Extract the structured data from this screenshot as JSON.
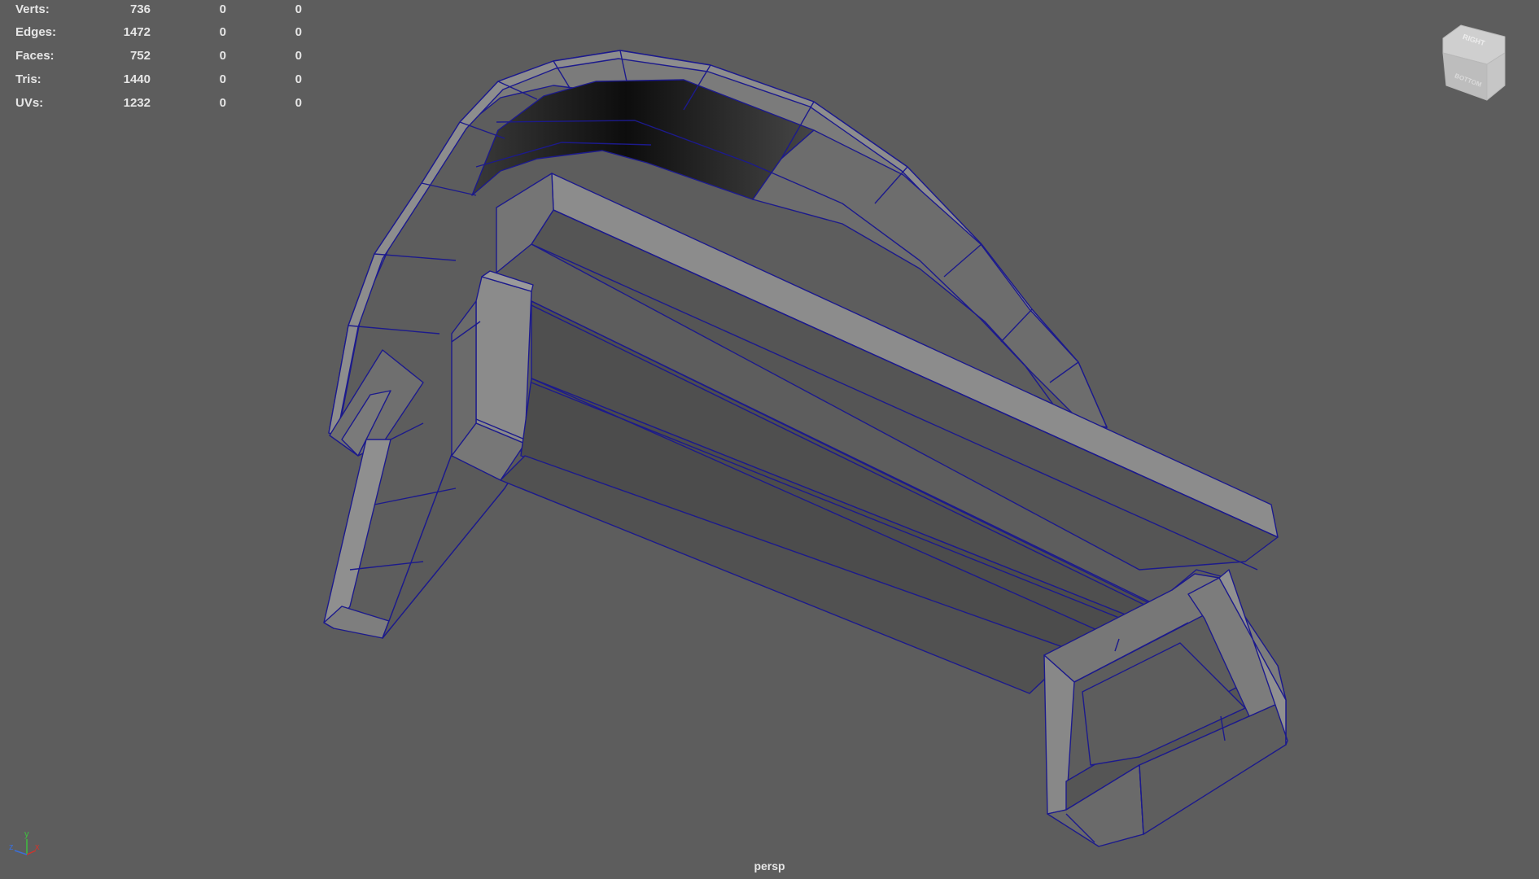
{
  "hud": {
    "rows": [
      {
        "label": "Verts:",
        "v1": "736",
        "v2": "0",
        "v3": "0"
      },
      {
        "label": "Edges:",
        "v1": "1472",
        "v2": "0",
        "v3": "0"
      },
      {
        "label": "Faces:",
        "v1": "752",
        "v2": "0",
        "v3": "0"
      },
      {
        "label": "Tris:",
        "v1": "1440",
        "v2": "0",
        "v3": "0"
      },
      {
        "label": "UVs:",
        "v1": "1232",
        "v2": "0",
        "v3": "0"
      }
    ]
  },
  "viewcube": {
    "face_right": "RIGHT",
    "face_bottom": "BOTTOM"
  },
  "axis_gizmo": {
    "x": "x",
    "y": "y",
    "z": "z"
  },
  "camera": {
    "name": "persp"
  },
  "colors": {
    "background": "#5d5d5d",
    "wireframe": "#1c1a8c",
    "face_light": "#8a8a8a",
    "face_mid": "#6f6f6f",
    "face_dark": "#4e4e4e",
    "text": "#e6e6e6",
    "axis_x": "#d0342c",
    "axis_y": "#3fbf3f",
    "axis_z": "#3b6fd8"
  }
}
